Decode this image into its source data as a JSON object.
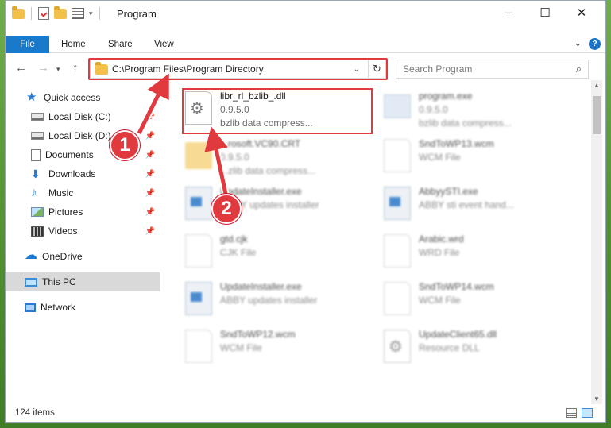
{
  "window": {
    "title": "Program"
  },
  "ribbon": {
    "tabs": [
      "File",
      "Home",
      "Share",
      "View"
    ]
  },
  "address": {
    "path": "C:\\Program Files\\Program Directory"
  },
  "search": {
    "placeholder": "Search Program"
  },
  "sidebar": {
    "items": [
      {
        "label": "Quick access",
        "icon": "star-icon"
      },
      {
        "label": "Local Disk (C:)",
        "icon": "disk-icon"
      },
      {
        "label": "Local Disk (D:)",
        "icon": "disk-icon"
      },
      {
        "label": "Documents",
        "icon": "documents-icon"
      },
      {
        "label": "Downloads",
        "icon": "download-icon"
      },
      {
        "label": "Music",
        "icon": "music-icon"
      },
      {
        "label": "Pictures",
        "icon": "pictures-icon"
      },
      {
        "label": "Videos",
        "icon": "videos-icon"
      },
      {
        "label": "OneDrive",
        "icon": "cloud-icon"
      },
      {
        "label": "This PC",
        "icon": "pc-icon"
      },
      {
        "label": "Network",
        "icon": "network-icon"
      }
    ]
  },
  "files": [
    {
      "name": "libr_rl_bzlib_.dll",
      "line2": "0.9.5.0",
      "line3": "bzlib data compress..."
    },
    {
      "name": "program.exe",
      "line2": "0.9.5.0",
      "line3": "bzlib data compress..."
    },
    {
      "name": "...rosoft.VC90.CRT",
      "line2": "0.9.5.0",
      "line3": "...zlib data compress..."
    },
    {
      "name": "SndToWP13.wcm",
      "line2": "WCM File"
    },
    {
      "name": "UpdateInstaller.exe",
      "line2": "...BBY updates installer"
    },
    {
      "name": "AbbyySTI.exe",
      "line2": "ABBY sti event hand..."
    },
    {
      "name": "gtd.cjk",
      "line2": "CJK File"
    },
    {
      "name": "Arabic.wrd",
      "line2": "WRD File"
    },
    {
      "name": "UpdateInstaller.exe",
      "line2": "ABBY updates installer"
    },
    {
      "name": "SndToWP14.wcm",
      "line2": "WCM File"
    },
    {
      "name": "SndToWP12.wcm",
      "line2": "WCM File"
    },
    {
      "name": "UpdateClient65.dll",
      "line2": "Resource DLL"
    }
  ],
  "status": {
    "count": "124 items"
  },
  "callouts": [
    "1",
    "2"
  ],
  "colors": {
    "accent": "#1979ca",
    "highlight": "#e0393e"
  }
}
